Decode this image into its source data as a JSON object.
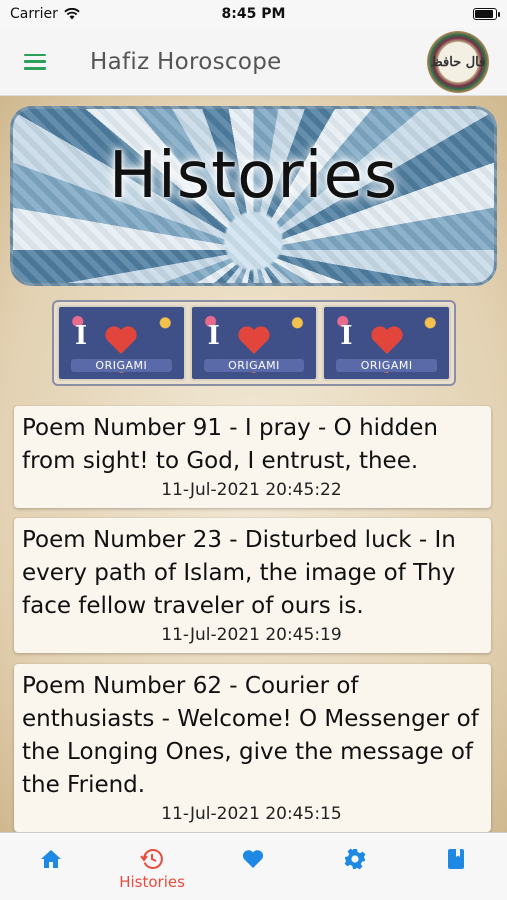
{
  "status_bar": {
    "carrier": "Carrier",
    "time": "8:45 PM"
  },
  "header": {
    "title": "Hafiz Horoscope",
    "logo_text": "فال حافظ"
  },
  "banner": {
    "title": "Histories"
  },
  "origami": {
    "tiles": [
      {
        "i": "I",
        "word": "ORIGAMI"
      },
      {
        "i": "I",
        "word": "ORIGAMI"
      },
      {
        "i": "I",
        "word": "ORIGAMI"
      }
    ]
  },
  "history": [
    {
      "text": "Poem Number 91 - I pray - O hidden from sight! to God, I entrust, thee.",
      "date": "11-Jul-2021 20:45:22"
    },
    {
      "text": "Poem Number 23 - Disturbed luck - In every path of Islam, the image of Thy face fellow traveler of ours is.",
      "date": "11-Jul-2021 20:45:19"
    },
    {
      "text": "Poem Number 62 - Courier of enthusiasts - Welcome! O Messenger of the Longing Ones, give the message of the Friend.",
      "date": "11-Jul-2021 20:45:15"
    }
  ],
  "tabs": [
    {
      "icon": "home-icon",
      "label": ""
    },
    {
      "icon": "history-icon",
      "label": "Histories",
      "active": true
    },
    {
      "icon": "heart-icon",
      "label": ""
    },
    {
      "icon": "gear-icon",
      "label": ""
    },
    {
      "icon": "book-icon",
      "label": ""
    }
  ],
  "colors": {
    "accent_green": "#2e9e5b",
    "tab_blue": "#1e88e5",
    "tab_active_red": "#e74c3c"
  }
}
